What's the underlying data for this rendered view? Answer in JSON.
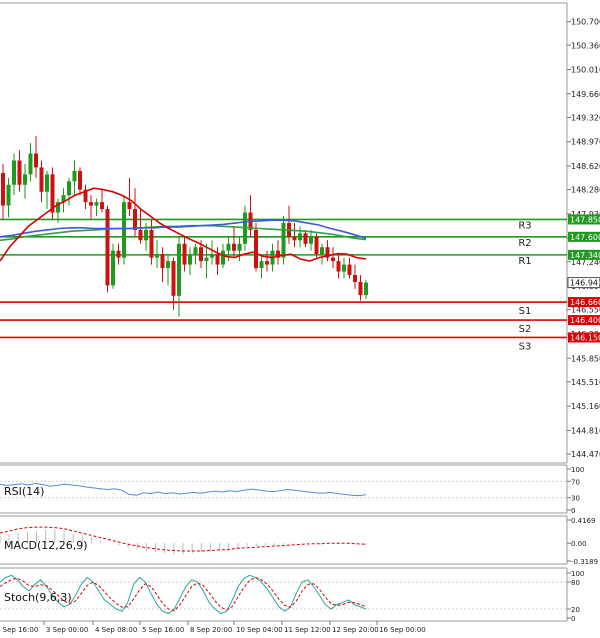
{
  "chart_data": {
    "type": "candlestick",
    "main": {
      "y_axis_ticks": [
        "150.700",
        "150.360",
        "150.010",
        "149.660",
        "149.320",
        "148.970",
        "148.620",
        "148.280",
        "147.930",
        "147.580",
        "147.240",
        "146.890",
        "146.550",
        "146.200",
        "145.850",
        "145.510",
        "145.160",
        "144.810",
        "144.470"
      ],
      "ylim": [
        144.37,
        150.94
      ],
      "current_price": "146.941",
      "levels": [
        {
          "name": "R3",
          "price": 147.85,
          "tag": "147.850",
          "color": "#1e9a1e"
        },
        {
          "name": "R2",
          "price": 147.6,
          "tag": "147.600",
          "color": "#1e9a1e"
        },
        {
          "name": "R1",
          "price": 147.34,
          "tag": "147.340",
          "color": "#1e9a1e"
        },
        {
          "name": "S1",
          "price": 146.66,
          "tag": "146.660",
          "color": "#dd0000"
        },
        {
          "name": "S2",
          "price": 146.4,
          "tag": "146.400",
          "color": "#dd0000"
        },
        {
          "name": "S3",
          "price": 146.15,
          "tag": "146.150",
          "color": "#dd0000"
        }
      ],
      "candles": [
        [
          148.52,
          148.65,
          147.85,
          148.05
        ],
        [
          148.05,
          148.45,
          147.88,
          148.35
        ],
        [
          148.35,
          148.8,
          148.2,
          148.7
        ],
        [
          148.7,
          148.85,
          148.25,
          148.35
        ],
        [
          148.35,
          148.65,
          148.15,
          148.5
        ],
        [
          148.5,
          148.95,
          148.4,
          148.8
        ],
        [
          148.8,
          149.05,
          148.45,
          148.6
        ],
        [
          148.6,
          148.7,
          148.1,
          148.25
        ],
        [
          148.25,
          148.55,
          148.0,
          148.5
        ],
        [
          148.5,
          148.6,
          147.85,
          147.95
        ],
        [
          147.95,
          148.15,
          147.8,
          148.1
        ],
        [
          148.1,
          148.3,
          147.95,
          148.2
        ],
        [
          148.2,
          148.45,
          148.05,
          148.4
        ],
        [
          148.4,
          148.7,
          148.2,
          148.55
        ],
        [
          148.55,
          148.6,
          148.2,
          148.28
        ],
        [
          148.28,
          148.35,
          148.0,
          148.1
        ],
        [
          148.1,
          148.2,
          147.85,
          148.05
        ],
        [
          148.05,
          148.15,
          147.9,
          148.1
        ],
        [
          148.1,
          148.3,
          147.95,
          148.0
        ],
        [
          148.0,
          148.05,
          146.8,
          146.9
        ],
        [
          146.9,
          147.5,
          146.85,
          147.4
        ],
        [
          147.4,
          147.5,
          147.2,
          147.3
        ],
        [
          147.3,
          148.2,
          147.2,
          148.1
        ],
        [
          148.1,
          148.45,
          147.9,
          148.0
        ],
        [
          148.0,
          148.3,
          147.6,
          147.7
        ],
        [
          147.7,
          148.0,
          147.5,
          147.55
        ],
        [
          147.55,
          147.8,
          147.4,
          147.7
        ],
        [
          147.7,
          147.85,
          147.2,
          147.3
        ],
        [
          147.3,
          147.55,
          147.15,
          147.35
        ],
        [
          147.35,
          147.45,
          146.95,
          147.15
        ],
        [
          147.15,
          147.35,
          146.9,
          147.25
        ],
        [
          147.25,
          147.3,
          146.55,
          146.75
        ],
        [
          146.75,
          147.6,
          146.45,
          147.5
        ],
        [
          147.5,
          147.6,
          147.1,
          147.2
        ],
        [
          147.2,
          147.45,
          147.05,
          147.35
        ],
        [
          147.35,
          147.5,
          147.2,
          147.45
        ],
        [
          147.45,
          147.55,
          147.15,
          147.25
        ],
        [
          147.25,
          147.5,
          147.0,
          147.3
        ],
        [
          147.3,
          147.55,
          147.2,
          147.35
        ],
        [
          147.35,
          147.45,
          147.05,
          147.2
        ],
        [
          147.2,
          147.5,
          147.15,
          147.4
        ],
        [
          147.4,
          147.6,
          147.25,
          147.5
        ],
        [
          147.5,
          147.75,
          147.3,
          147.4
        ],
        [
          147.4,
          147.6,
          147.25,
          147.5
        ],
        [
          147.5,
          148.05,
          147.4,
          147.95
        ],
        [
          147.95,
          148.2,
          147.6,
          147.7
        ],
        [
          147.7,
          147.8,
          147.1,
          147.15
        ],
        [
          147.15,
          147.35,
          147.0,
          147.25
        ],
        [
          147.25,
          147.4,
          147.1,
          147.2
        ],
        [
          147.2,
          147.5,
          147.1,
          147.4
        ],
        [
          147.4,
          147.55,
          147.2,
          147.3
        ],
        [
          147.3,
          147.9,
          147.2,
          147.8
        ],
        [
          147.8,
          148.05,
          147.5,
          147.6
        ],
        [
          147.6,
          147.8,
          147.45,
          147.55
        ],
        [
          147.55,
          147.75,
          147.45,
          147.65
        ],
        [
          147.65,
          147.7,
          147.45,
          147.5
        ],
        [
          147.5,
          147.7,
          147.4,
          147.6
        ],
        [
          147.6,
          147.65,
          147.3,
          147.35
        ],
        [
          147.35,
          147.5,
          147.2,
          147.45
        ],
        [
          147.45,
          147.55,
          147.25,
          147.3
        ],
        [
          147.3,
          147.45,
          147.15,
          147.25
        ],
        [
          147.25,
          147.35,
          147.0,
          147.1
        ],
        [
          147.1,
          147.3,
          147.0,
          147.2
        ],
        [
          147.2,
          147.3,
          147.0,
          147.05
        ],
        [
          147.05,
          147.2,
          146.85,
          146.95
        ],
        [
          146.95,
          147.05,
          146.68,
          146.76
        ],
        [
          146.76,
          146.98,
          146.7,
          146.94
        ]
      ],
      "ma_red": [
        147.25,
        147.45,
        147.6,
        147.75,
        147.85,
        147.95,
        148.05,
        148.12,
        148.2,
        148.25,
        148.3,
        148.28,
        148.25,
        148.2,
        148.12,
        148.0,
        147.9,
        147.8,
        147.72,
        147.65,
        147.58,
        147.52,
        147.45,
        147.38,
        147.32,
        147.3,
        147.35,
        147.38,
        147.32,
        147.3,
        147.33,
        147.35,
        147.28,
        147.25,
        147.3,
        147.33,
        147.36,
        147.35,
        147.3,
        147.28
      ],
      "ma_blue": [
        147.6,
        147.62,
        147.65,
        147.68,
        147.7,
        147.72,
        147.73,
        147.73,
        147.72,
        147.72,
        147.72,
        147.72,
        147.73,
        147.73,
        147.74,
        147.74,
        147.75,
        147.76,
        147.77,
        147.78,
        147.8,
        147.82,
        147.83,
        147.84,
        147.84,
        147.83,
        147.8,
        147.77,
        147.72,
        147.68,
        147.63,
        147.58
      ],
      "ma_green": [
        147.55,
        147.57,
        147.6,
        147.62,
        147.64,
        147.66,
        147.68,
        147.69,
        147.7,
        147.71,
        147.72,
        147.72,
        147.73,
        147.74,
        147.75,
        147.75,
        147.76,
        147.76,
        147.76,
        147.75,
        147.74,
        147.73,
        147.72,
        147.71,
        147.7,
        147.69,
        147.68,
        147.66,
        147.64,
        147.61,
        147.58,
        147.56
      ]
    },
    "rsi": {
      "label": "RSI(14)",
      "ticks": [
        "100",
        "70",
        "30",
        "0"
      ],
      "ylim": [
        0,
        100
      ],
      "values": [
        63,
        60,
        62,
        64,
        61,
        65,
        62,
        58,
        60,
        63,
        61,
        59,
        56,
        54,
        52,
        50,
        52,
        48,
        38,
        36,
        42,
        40,
        44,
        40,
        42,
        39,
        41,
        43,
        41,
        44,
        46,
        44,
        47,
        45,
        48,
        51,
        49,
        46,
        45,
        47,
        50,
        48,
        46,
        44,
        42,
        41,
        43,
        40,
        38,
        36,
        35,
        37
      ]
    },
    "macd": {
      "label": "MACD(12,26,9)",
      "ticks": [
        "0.4169",
        "0.00",
        "-0.3189"
      ],
      "ylim": [
        -0.3189,
        0.4169
      ],
      "hist": [
        0.14,
        0.16,
        0.18,
        0.2,
        0.22,
        0.24,
        0.24,
        0.22,
        0.18,
        0.14,
        0.1,
        0.05,
        0.0,
        -0.04,
        -0.08,
        -0.1,
        -0.14,
        -0.16,
        -0.18,
        -0.2,
        -0.2,
        -0.18,
        -0.16,
        -0.15,
        -0.12,
        -0.1,
        -0.08,
        -0.06,
        -0.05,
        -0.04,
        -0.03,
        -0.02,
        -0.01,
        0.0,
        0.0,
        -0.01,
        -0.01,
        -0.02,
        -0.02,
        -0.02,
        -0.03
      ],
      "signal": [
        0.18,
        0.22,
        0.26,
        0.28,
        0.29,
        0.29,
        0.28,
        0.26,
        0.22,
        0.18,
        0.14,
        0.1,
        0.06,
        0.02,
        -0.02,
        -0.05,
        -0.08,
        -0.1,
        -0.12,
        -0.13,
        -0.14,
        -0.14,
        -0.14,
        -0.13,
        -0.12,
        -0.11,
        -0.09,
        -0.08,
        -0.07,
        -0.06,
        -0.05,
        -0.04,
        -0.03,
        -0.02,
        -0.01,
        -0.01,
        0.0,
        0.0,
        0.0,
        -0.01,
        -0.02
      ]
    },
    "stoch": {
      "label": "Stoch(9,6,3)",
      "ticks": [
        "100",
        "80",
        "20",
        "0"
      ],
      "ylim": [
        0,
        100
      ],
      "main": [
        80,
        90,
        95,
        85,
        70,
        60,
        75,
        85,
        70,
        50,
        35,
        25,
        30,
        50,
        75,
        90,
        80,
        60,
        40,
        30,
        20,
        15,
        35,
        75,
        90,
        80,
        55,
        30,
        15,
        10,
        20,
        45,
        70,
        85,
        80,
        60,
        35,
        20,
        10,
        15,
        40,
        70,
        88,
        95,
        90,
        80,
        65,
        45,
        25,
        15,
        25,
        55,
        80,
        85,
        70,
        50,
        30,
        20,
        30,
        35,
        40,
        30,
        25,
        20
      ],
      "signal": [
        70,
        78,
        86,
        88,
        82,
        72,
        70,
        74,
        72,
        62,
        50,
        38,
        32,
        38,
        55,
        72,
        80,
        72,
        58,
        44,
        32,
        24,
        25,
        42,
        62,
        76,
        70,
        52,
        32,
        20,
        16,
        30,
        50,
        70,
        78,
        72,
        56,
        38,
        24,
        18,
        26,
        48,
        68,
        84,
        90,
        85,
        75,
        60,
        42,
        28,
        24,
        38,
        60,
        75,
        76,
        64,
        46,
        32,
        28,
        30,
        35,
        34,
        30,
        25
      ]
    },
    "x_axis_labels": [
      "2 Sep 16:00",
      "3 Sep 00:00",
      "4 Sep 08:00",
      "5 Sep 16:00",
      "8 Sep 20:00",
      "10 Sep 04:00",
      "11 Sep 12:00",
      "12 Sep 20:00",
      "16 Sep 00:00"
    ],
    "colors": {
      "bull": "#1e9a1e",
      "bear": "#cc1111",
      "ma_red": "#dd0000",
      "ma_blue": "#3b5bdb",
      "ma_green": "#2f9e44",
      "rsi": "#4d8fe0",
      "macd_signal": "#dd0000",
      "macd_hist": "#bbbbbb",
      "stoch_main": "#2aa7a0",
      "stoch_signal": "#dd0000"
    }
  }
}
